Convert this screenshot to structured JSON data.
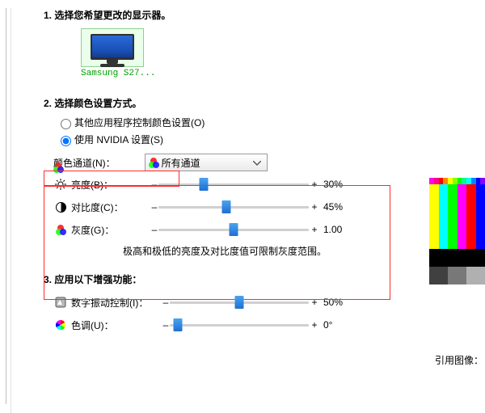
{
  "section1": {
    "title": "1.  选择您希望更改的显示器。"
  },
  "monitor": {
    "label": "Samsung S27..."
  },
  "section2": {
    "title": "2.  选择颜色设置方式。"
  },
  "radios": {
    "other": "其他应用程序控制颜色设置(O)",
    "nvidia": "使用 NVIDIA 设置(S)"
  },
  "channel": {
    "label": "颜色通道(N)：",
    "value": "所有通道"
  },
  "sliders": {
    "brightness": {
      "label": "亮度(B)：",
      "value": "30%",
      "pos": 30
    },
    "contrast": {
      "label": "对比度(C)：",
      "value": "45%",
      "pos": 45
    },
    "gamma": {
      "label": "灰度(G)：",
      "value": "1.00",
      "pos": 50
    }
  },
  "note": "极高和极低的亮度及对比度值可限制灰度范围。",
  "section3": {
    "title": "3.  应用以下增强功能："
  },
  "enhance": {
    "vibrance": {
      "label": "数字振动控制(I)：",
      "value": "50%",
      "pos": 50
    },
    "hue": {
      "label": "色调(U)：",
      "value": "0°",
      "pos": 6
    }
  },
  "preview_label": "引用图像："
}
